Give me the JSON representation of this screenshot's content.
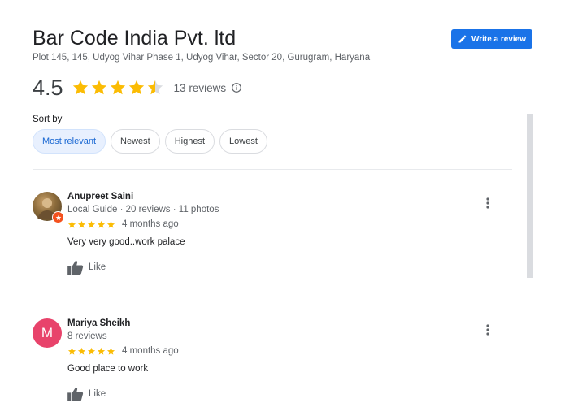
{
  "business": {
    "name": "Bar Code India Pvt. ltd",
    "address": "Plot 145, 145, Udyog Vihar Phase 1, Udyog Vihar, Sector 20, Gurugram, Haryana"
  },
  "write_review_label": "Write a review",
  "rating": {
    "value": "4.5",
    "stars": 4.5,
    "count_label": "13 reviews"
  },
  "sort": {
    "label": "Sort by",
    "options": [
      "Most relevant",
      "Newest",
      "Highest",
      "Lowest"
    ],
    "selected": "Most relevant"
  },
  "reviews": [
    {
      "name": "Anupreet Saini",
      "meta": "Local Guide · 20 reviews · 11 photos",
      "stars": 5,
      "date": "4 months ago",
      "text": "Very very good..work palace",
      "like_label": "Like",
      "avatar_type": "photo",
      "local_guide": true
    },
    {
      "name": "Mariya Sheikh",
      "meta": "8 reviews",
      "stars": 5,
      "date": "4 months ago",
      "text": "Good place to work",
      "like_label": "Like",
      "avatar_type": "letter",
      "avatar_letter": "M",
      "local_guide": false
    }
  ],
  "colors": {
    "accent": "#1a73e8",
    "star": "#fbbc04",
    "avatar_letter_bg": "#e8436b",
    "guide_badge": "#f4511e"
  }
}
